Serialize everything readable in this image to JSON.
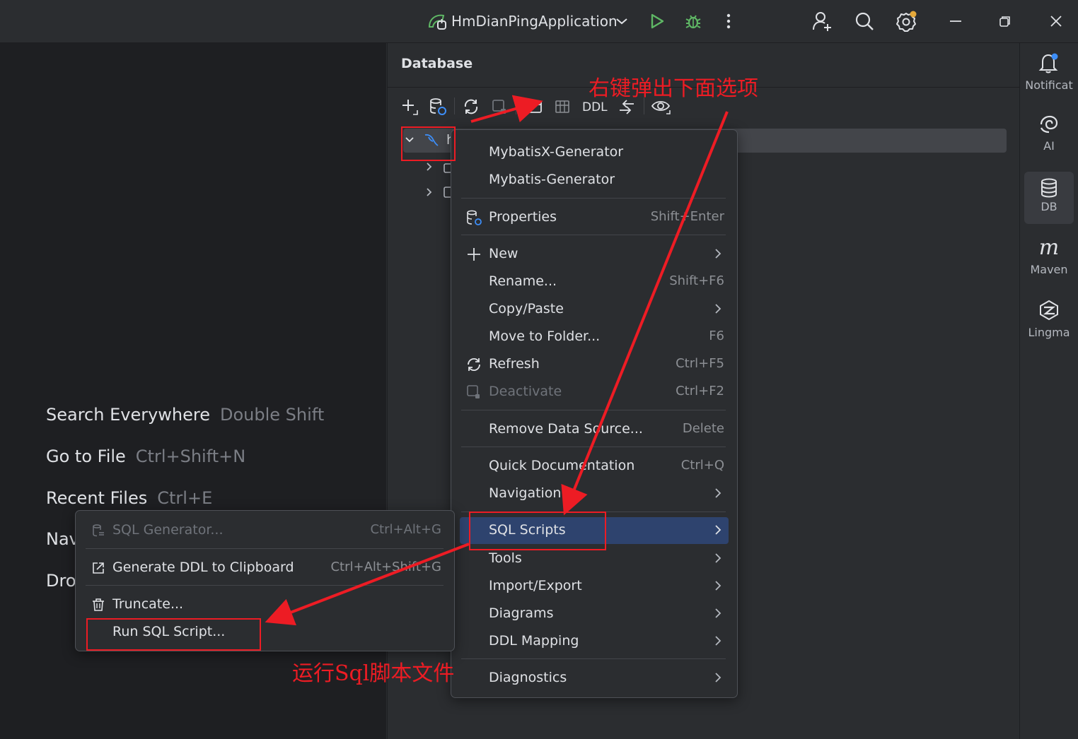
{
  "titlebar": {
    "run_config": "HmDianPingApplication"
  },
  "editor_hints": [
    {
      "label": "Search Everywhere",
      "shortcut": "Double Shift"
    },
    {
      "label": "Go to File",
      "shortcut": "Ctrl+Shift+N"
    },
    {
      "label": "Recent Files",
      "shortcut": "Ctrl+E"
    },
    {
      "label": "Nav",
      "shortcut": ""
    },
    {
      "label": "Dro",
      "shortcut": ""
    }
  ],
  "database_panel": {
    "title": "Database",
    "toolbar": {
      "ddl_label": "DDL"
    },
    "tree_root_label": "h"
  },
  "right_stripe": [
    {
      "label": "Notificat",
      "icon": "bell-icon"
    },
    {
      "label": "AI",
      "icon": "ai-spiral-icon"
    },
    {
      "label": "DB",
      "icon": "database-icon"
    },
    {
      "label": "Maven",
      "icon": "maven-icon"
    },
    {
      "label": "Lingma",
      "icon": "lingma-icon"
    }
  ],
  "context_menu": {
    "items": [
      {
        "label": "MybatisX-Generator"
      },
      {
        "label": "Mybatis-Generator"
      },
      {
        "label": "Properties",
        "shortcut": "Shift+Enter"
      },
      {
        "label": "New"
      },
      {
        "label": "Rename...",
        "shortcut": "Shift+F6"
      },
      {
        "label": "Copy/Paste"
      },
      {
        "label": "Move to Folder...",
        "shortcut": "F6"
      },
      {
        "label": "Refresh",
        "shortcut": "Ctrl+F5"
      },
      {
        "label": "Deactivate",
        "shortcut": "Ctrl+F2"
      },
      {
        "label": "Remove Data Source...",
        "shortcut": "Delete"
      },
      {
        "label": "Quick Documentation",
        "shortcut": "Ctrl+Q"
      },
      {
        "label": "Navigation"
      },
      {
        "label": "SQL Scripts"
      },
      {
        "label": "Tools"
      },
      {
        "label": "Import/Export"
      },
      {
        "label": "Diagrams"
      },
      {
        "label": "DDL Mapping"
      },
      {
        "label": "Diagnostics"
      }
    ]
  },
  "sql_scripts_submenu": {
    "items": [
      {
        "label": "SQL Generator...",
        "shortcut": "Ctrl+Alt+G"
      },
      {
        "label": "Generate DDL to Clipboard",
        "shortcut": "Ctrl+Alt+Shift+G"
      },
      {
        "label": "Truncate..."
      },
      {
        "label": "Run SQL Script..."
      }
    ]
  },
  "annotations": {
    "top_note": "右键弹出下面选项",
    "bottom_note": "运行Sql脚本文件",
    "color": "#ed1c24"
  },
  "colors": {
    "accent_selection": "#2e436e",
    "run_green": "#5fb865",
    "settings_badge": "#e5a93a",
    "notification_badge": "#3d8ef8"
  }
}
